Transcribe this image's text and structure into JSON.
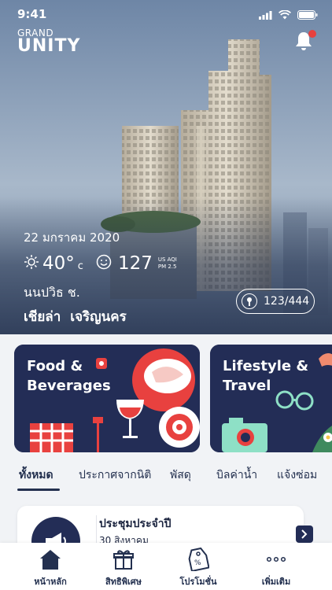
{
  "status_bar": {
    "time": "9:41"
  },
  "brand": {
    "line1": "GRAND",
    "line2": "UNITY"
  },
  "weather": {
    "date": "22 มกราคม 2020",
    "temperature": "40°",
    "temperature_unit": "c",
    "aqi": "127",
    "aqi_label_1": "US AQI",
    "aqi_label_2": "PM 2.5"
  },
  "resident": {
    "title": "นนปวิธ ช.",
    "first_name": "เชียล่า",
    "last_name": "เจริญนคร"
  },
  "unit_badge": "123/444",
  "categories": [
    {
      "title_line1": "Food &",
      "title_line2": "Beverages"
    },
    {
      "title_line1": "Lifestyle &",
      "title_line2": "Travel"
    }
  ],
  "tabs": [
    {
      "label": "ทั้งหมด"
    },
    {
      "label": "ประกาศจากนิติ"
    },
    {
      "label": "พัสดุ"
    },
    {
      "label": "บิลค่าน้ำ"
    },
    {
      "label": "แจ้งซ่อม"
    }
  ],
  "news": {
    "title": "ประชุมประจำปี",
    "date": "30 สิงหาคม"
  },
  "bottom_nav": [
    {
      "label": "หน้าหลัก",
      "icon": "home-icon"
    },
    {
      "label": "สิทธิพิเศษ",
      "icon": "gift-icon"
    },
    {
      "label": "โปรโมชั่น",
      "icon": "tag-icon"
    },
    {
      "label": "เพิ่มเติม",
      "icon": "more-icon"
    }
  ],
  "colors": {
    "navy": "#232d56",
    "accent_red": "#e8413f",
    "background": "#f1f3f6"
  }
}
